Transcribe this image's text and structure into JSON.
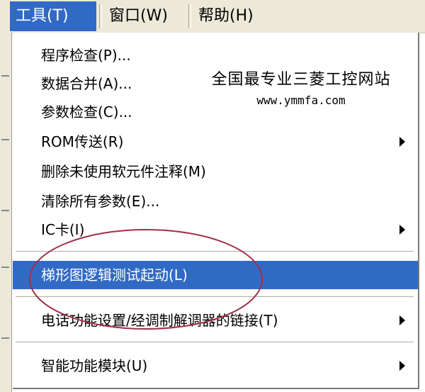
{
  "menubar": {
    "items": [
      {
        "label": "工具(T)",
        "active": true
      },
      {
        "label": "窗口(W)",
        "active": false
      },
      {
        "label": "帮助(H)",
        "active": false
      }
    ]
  },
  "menu": {
    "items": [
      {
        "label": "程序检查(P)...",
        "submenu": false,
        "highlighted": false
      },
      {
        "label": "数据合并(A)...",
        "submenu": false,
        "highlighted": false
      },
      {
        "label": "参数检查(C)...",
        "submenu": false,
        "highlighted": false
      },
      {
        "label": "ROM传送(R)",
        "submenu": true,
        "highlighted": false
      },
      {
        "label": "删除未使用软元件注释(M)",
        "submenu": false,
        "highlighted": false
      },
      {
        "label": "清除所有参数(E)...",
        "submenu": false,
        "highlighted": false
      },
      {
        "label": "IC卡(I)",
        "submenu": true,
        "highlighted": false
      },
      {
        "label": "梯形图逻辑测试起动(L)",
        "submenu": false,
        "highlighted": true
      },
      {
        "label": "电话功能设置/经调制解调器的链接(T)",
        "submenu": true,
        "highlighted": false
      },
      {
        "label": "智能功能模块(U)",
        "submenu": true,
        "highlighted": false
      }
    ]
  },
  "watermark": {
    "line1": "全国最专业三菱工控网站",
    "line2": "www.ymmfa.com"
  },
  "colors": {
    "highlight": "#316ac5",
    "menubar_bg": "#ece9d8",
    "annotation_circle": "#a0304a"
  }
}
